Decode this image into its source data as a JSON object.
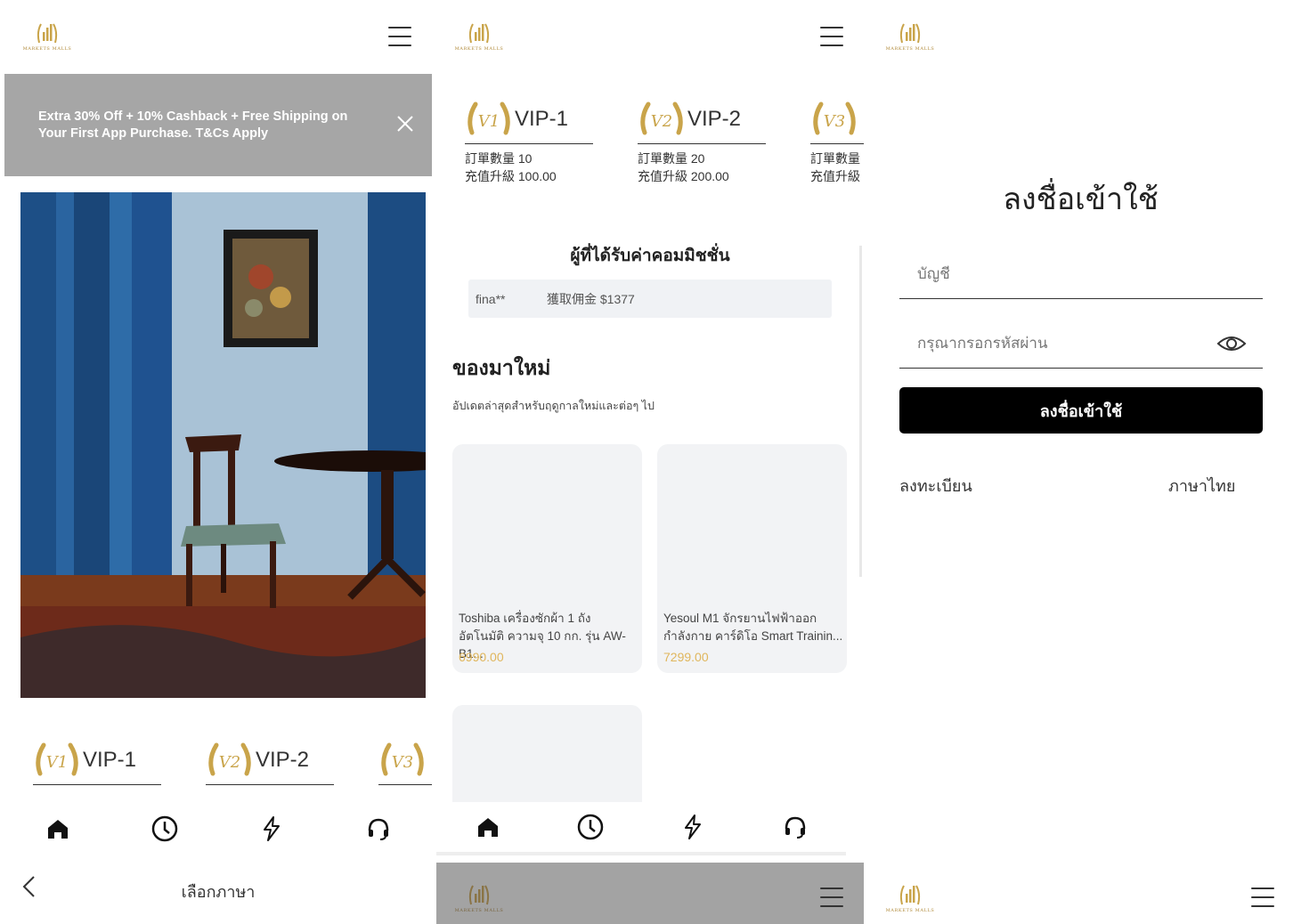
{
  "logo": {
    "brand_text": "MARKETS MALLS"
  },
  "colors": {
    "gold": "#c9a44a",
    "price": "#e0b65c",
    "promo_bg": "#a6a6a6",
    "login_button": "#000000"
  },
  "icons": {
    "menu": "hamburger-icon",
    "close": "close-icon",
    "home": "home-icon",
    "history": "clock-icon",
    "lightning": "lightning-icon",
    "support": "headset-icon",
    "back": "chevron-left-icon",
    "eye": "eye-icon"
  },
  "home_screen": {
    "promo_text": "Extra 30% Off + 10% Cashback + Free Shipping on Your First App Purchase. T&Cs Apply",
    "vip_levels": [
      {
        "badge": "V1",
        "name": "VIP-1"
      },
      {
        "badge": "V2",
        "name": "VIP-2"
      },
      {
        "badge": "V3",
        "name": ""
      }
    ]
  },
  "vip_screen": {
    "vip_levels": [
      {
        "badge": "V1",
        "name": "VIP-1",
        "orders": "訂單數量 10",
        "upgrade": "充值升級 100.00"
      },
      {
        "badge": "V2",
        "name": "VIP-2",
        "orders": "訂單數量 20",
        "upgrade": "充值升級 200.00"
      },
      {
        "badge": "V3",
        "name": "",
        "orders": "訂單數量",
        "upgrade": "充值升級"
      }
    ],
    "commission_title": "ผู้ที่ได้รับค่าคอมมิชชั่น",
    "commission_user": "fina**",
    "commission_text": "獲取佣金 $1377",
    "new_arrivals_title": "ของมาใหม่",
    "new_arrivals_subtitle": "อัปเดตล่าสุดสำหรับฤดูกาลใหม่และต่อๆ ไป",
    "products": [
      {
        "name": "Toshiba เครื่องซักผ้า 1 ถัง อัตโนมัติ ความจุ 10 กก. รุ่น AW-B1...",
        "price": "6990.00"
      },
      {
        "name": "Yesoul M1 จักรยานไฟฟ้าออกกำลังกาย คาร์ดิโอ Smart Trainin...",
        "price": "7299.00"
      }
    ]
  },
  "language_screen": {
    "back_label": "<",
    "title": "เลือกภาษา"
  },
  "login_screen": {
    "title": "ลงชื่อเข้าใช้",
    "account_placeholder": "บัญชี",
    "password_placeholder": "กรุณากรอกรหัสผ่าน",
    "login_button": "ลงชื่อเข้าใช้",
    "register_link": "ลงทะเบียน",
    "language_link": "ภาษาไทย"
  }
}
